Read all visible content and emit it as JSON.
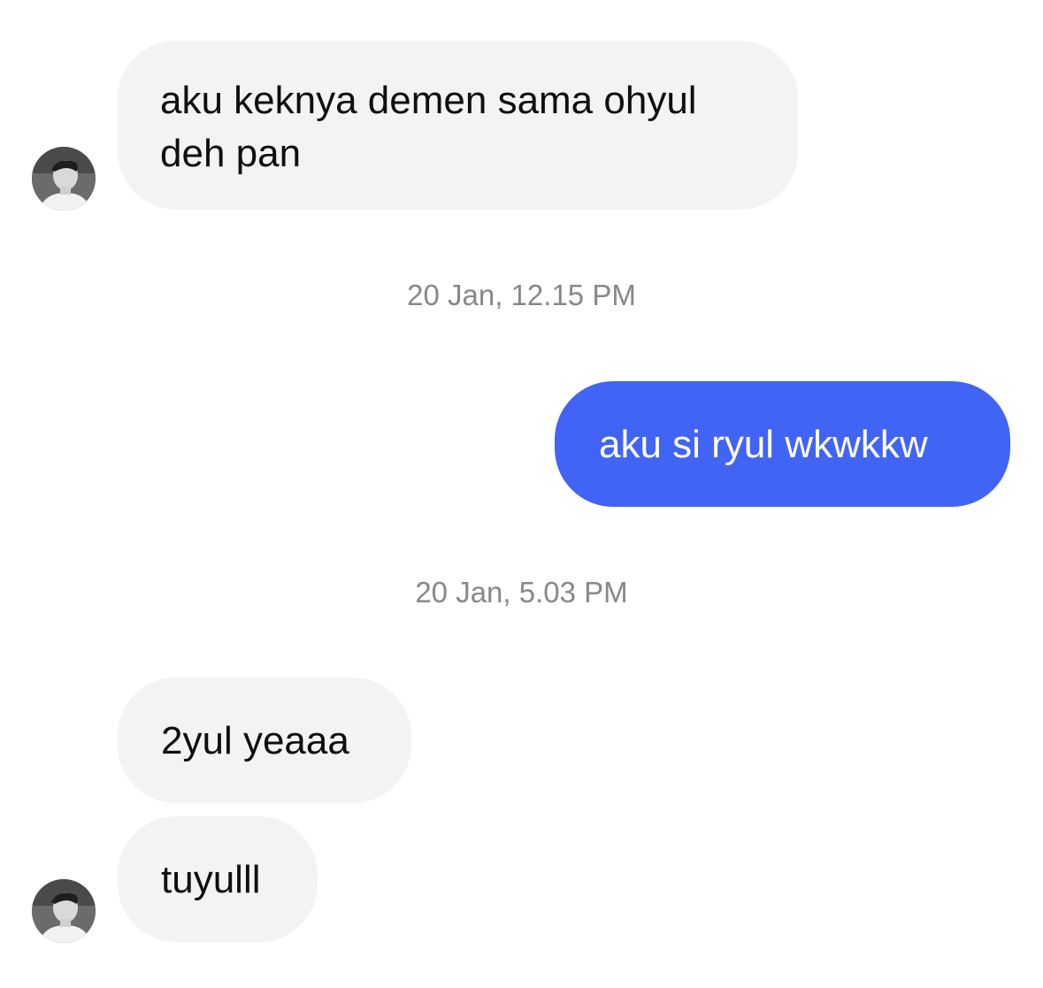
{
  "messages": [
    {
      "direction": "incoming",
      "text": "aku keknya demen sama ohyul\ndeh pan"
    },
    {
      "direction": "outgoing",
      "text": "aku si ryul wkwkkw"
    },
    {
      "direction": "incoming",
      "text": "2yul yeaaa"
    },
    {
      "direction": "incoming",
      "text": "tuyulll"
    }
  ],
  "timestamps": [
    "20 Jan, 12.15 PM",
    "20 Jan, 5.03 PM"
  ],
  "avatars": [
    {
      "icon": "contact-avatar"
    },
    {
      "icon": "contact-avatar"
    }
  ],
  "colors": {
    "incoming_bubble": "#f3f3f3",
    "outgoing_bubble": "#4164f4",
    "timestamp_text": "#888888"
  }
}
